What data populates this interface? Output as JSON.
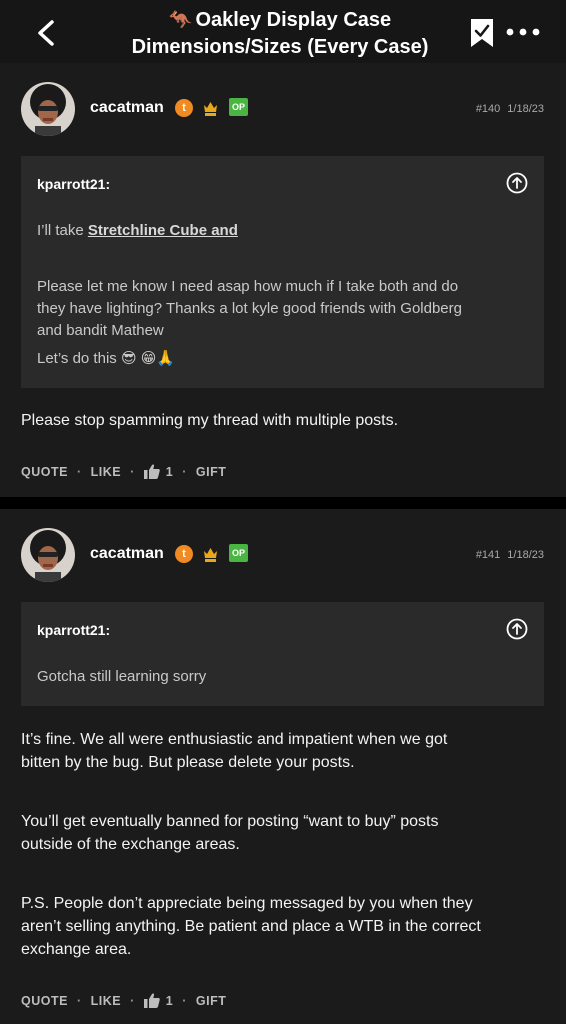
{
  "header": {
    "title_emoji": "🦘",
    "title_line1": "Oakley Display Case",
    "title_line2": "Dimensions/Sizes (Every Case)"
  },
  "posts": [
    {
      "author": "cacatman",
      "badge_orange": "t",
      "badge_op": "OP",
      "number": "#140",
      "date": "1/18/23",
      "quote": {
        "author": "kparrott21:",
        "line1_prefix": "I’ll take ",
        "line1_link": "Stretchline Cube and",
        "paragraph": [
          "Please let me know I need asap how much if I take both and do",
          "they have lighting? Thanks a lot kyle good friends with Goldberg",
          "and bandit Mathew"
        ],
        "last_line": "Let’s do this 😎 😁🙏"
      },
      "body": [
        "Please stop spamming my thread with multiple posts."
      ],
      "actions": {
        "quote": "QUOTE",
        "like": "LIKE",
        "like_count": "1",
        "gift": "GIFT"
      }
    },
    {
      "author": "cacatman",
      "badge_orange": "t",
      "badge_op": "OP",
      "number": "#141",
      "date": "1/18/23",
      "quote": {
        "author": "kparrott21:",
        "text": "Gotcha still learning sorry"
      },
      "body": [
        "It’s fine. We all were enthusiastic and impatient when we got",
        "bitten by the bug. But please delete your posts.",
        "You’ll get eventually banned for posting “want to buy” posts",
        "outside of the exchange areas.",
        "P.S. People don’t appreciate being messaged by you when they",
        "aren’t selling anything. Be patient and place a WTB in the correct",
        "exchange area."
      ],
      "actions": {
        "quote": "QUOTE",
        "like": "LIKE",
        "like_count": "1",
        "gift": "GIFT"
      }
    }
  ],
  "colors": {
    "background": "#000000",
    "post_background": "#1b1b1b",
    "quote_background": "#2a2a2a",
    "badge_orange": "#f08a22",
    "badge_op": "#4bb543"
  }
}
